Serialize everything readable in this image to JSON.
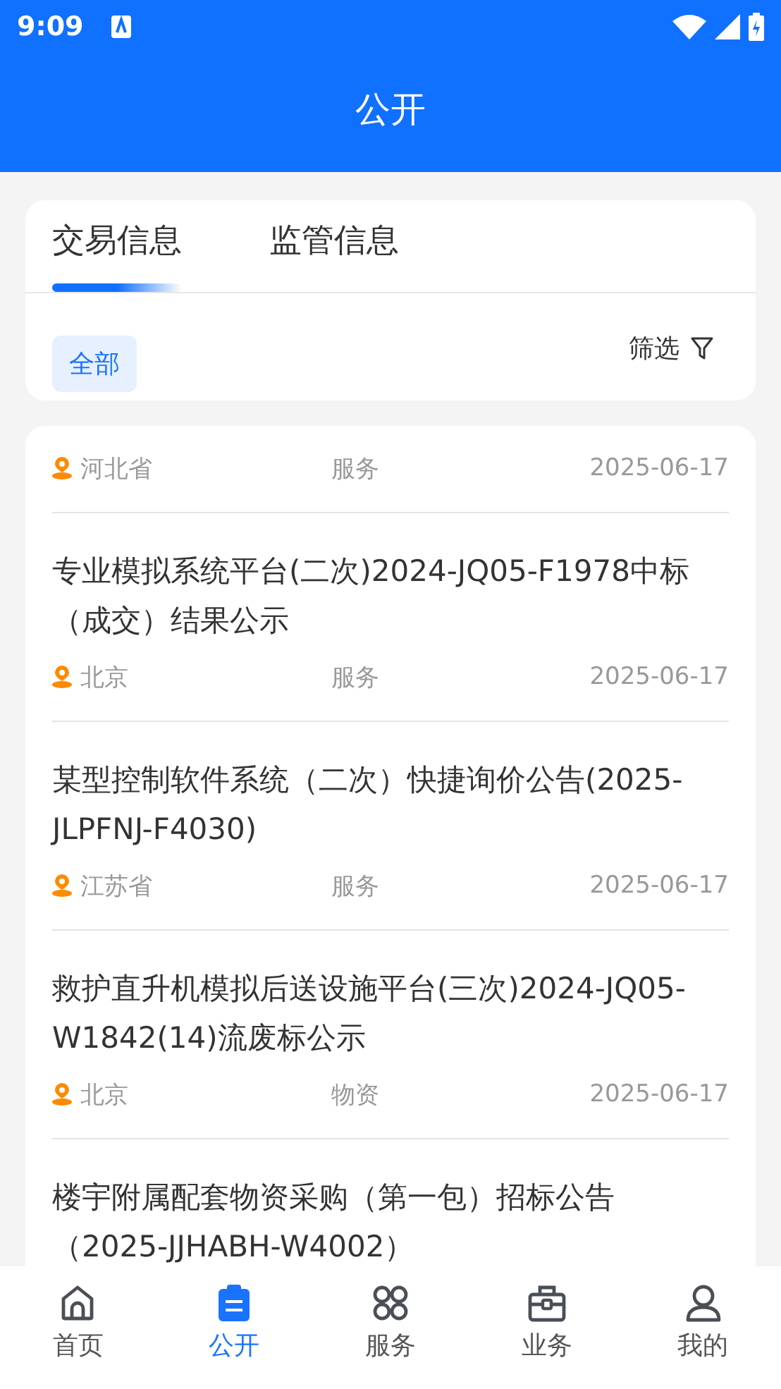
{
  "status_bar": {
    "time": "9:09"
  },
  "header": {
    "title": "公开"
  },
  "tabs": [
    {
      "label": "交易信息",
      "selected": true
    },
    {
      "label": "监管信息",
      "selected": false
    }
  ],
  "filter": {
    "chip": "全部",
    "chip_selected": true,
    "label": "筛选"
  },
  "notices": [
    {
      "region": "河北省",
      "category": "服务",
      "date": "2025-06-17"
    },
    {
      "title": "专业模拟系统平台(二次)2024-JQ05-F1978中标（成交）结果公示",
      "region": "北京",
      "category": "服务",
      "date": "2025-06-17"
    },
    {
      "title": "某型控制软件系统（二次）快捷询价公告(2025-JLPFNJ-F4030)",
      "region": "江苏省",
      "category": "服务",
      "date": "2025-06-17"
    },
    {
      "title": "救护直升机模拟后送设施平台(三次)2024-JQ05-W1842(14)流废标公示",
      "region": "北京",
      "category": "物资",
      "date": "2025-06-17"
    },
    {
      "title": "楼宇附属配套物资采购（第一包）招标公告（2025-JJHABH-W4002）"
    }
  ],
  "nav": [
    {
      "kind": "home",
      "label": "首页",
      "selected": false
    },
    {
      "kind": "clipboard",
      "label": "公开",
      "selected": true
    },
    {
      "kind": "grid",
      "label": "服务",
      "selected": false
    },
    {
      "kind": "toolbox",
      "label": "业务",
      "selected": false
    },
    {
      "kind": "person",
      "label": "我的",
      "selected": false
    }
  ]
}
